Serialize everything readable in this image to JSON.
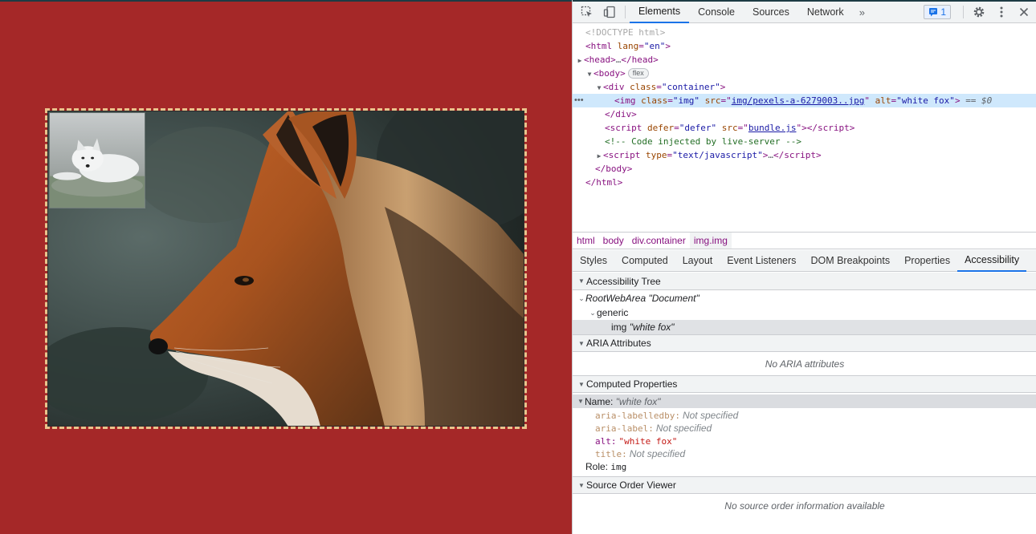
{
  "page": {
    "background_color": "#a52828",
    "border_color": "#e9c48c",
    "main_image_alt": "red fox",
    "thumb_image_alt": "white fox"
  },
  "devtools": {
    "toolbar": {
      "tabs": [
        "Elements",
        "Console",
        "Sources",
        "Network"
      ],
      "active_tab": "Elements",
      "more_tabs": "»",
      "issues_count": "1"
    },
    "dom": {
      "doctype": "<!DOCTYPE html>",
      "html_open_tag": "html",
      "html_lang_attr": "lang",
      "html_lang_val": "\"en\"",
      "head": "head",
      "head_ellipsis": "…",
      "body": "body",
      "body_badge": "flex",
      "div_tag": "div",
      "div_class_attr": "class",
      "div_class_val": "\"container\"",
      "img_tag": "img",
      "img_class_attr": "class",
      "img_class_val": "\"img\"",
      "img_src_attr": "src",
      "img_src_val": "img/pexels-a-6279003..jpg",
      "img_alt_attr": "alt",
      "img_alt_val": "\"white fox\"",
      "img_suffix": "== $0",
      "div_close": "</div>",
      "script_tag": "script",
      "script_defer_attr": "defer",
      "script_defer_val": "\"defer\"",
      "script_src_attr": "src",
      "script_src_val": "bundle.js",
      "comment": "<!-- Code injected by live-server -->",
      "script2_type_attr": "type",
      "script2_type_val": "\"text/javascript\"",
      "script2_ellipsis": "…",
      "body_close": "</body>",
      "html_close": "</html>"
    },
    "breadcrumbs": [
      "html",
      "body",
      "div.container",
      "img.img"
    ],
    "active_breadcrumb": "img.img",
    "subtabs": [
      "Styles",
      "Computed",
      "Layout",
      "Event Listeners",
      "DOM Breakpoints",
      "Properties",
      "Accessibility"
    ],
    "active_subtab": "Accessibility",
    "a11y": {
      "tree_title": "Accessibility Tree",
      "root_role": "RootWebArea",
      "root_name": "\"Document\"",
      "generic_role": "generic",
      "img_role": "img",
      "img_name": "\"white fox\"",
      "aria_title": "ARIA Attributes",
      "aria_empty": "No ARIA attributes",
      "computed_title": "Computed Properties",
      "name_label": "Name:",
      "name_value": "\"white fox\"",
      "props": [
        {
          "key": "aria-labelledby:",
          "value": "Not specified",
          "kind": "na"
        },
        {
          "key": "aria-label:",
          "value": "Not specified",
          "kind": "na"
        },
        {
          "key": "alt:",
          "value": "\"white fox\"",
          "kind": "str"
        },
        {
          "key": "title:",
          "value": "Not specified",
          "kind": "na"
        }
      ],
      "role_label": "Role:",
      "role_value": "img",
      "source_order_title": "Source Order Viewer",
      "source_order_empty": "No source order information available"
    }
  }
}
